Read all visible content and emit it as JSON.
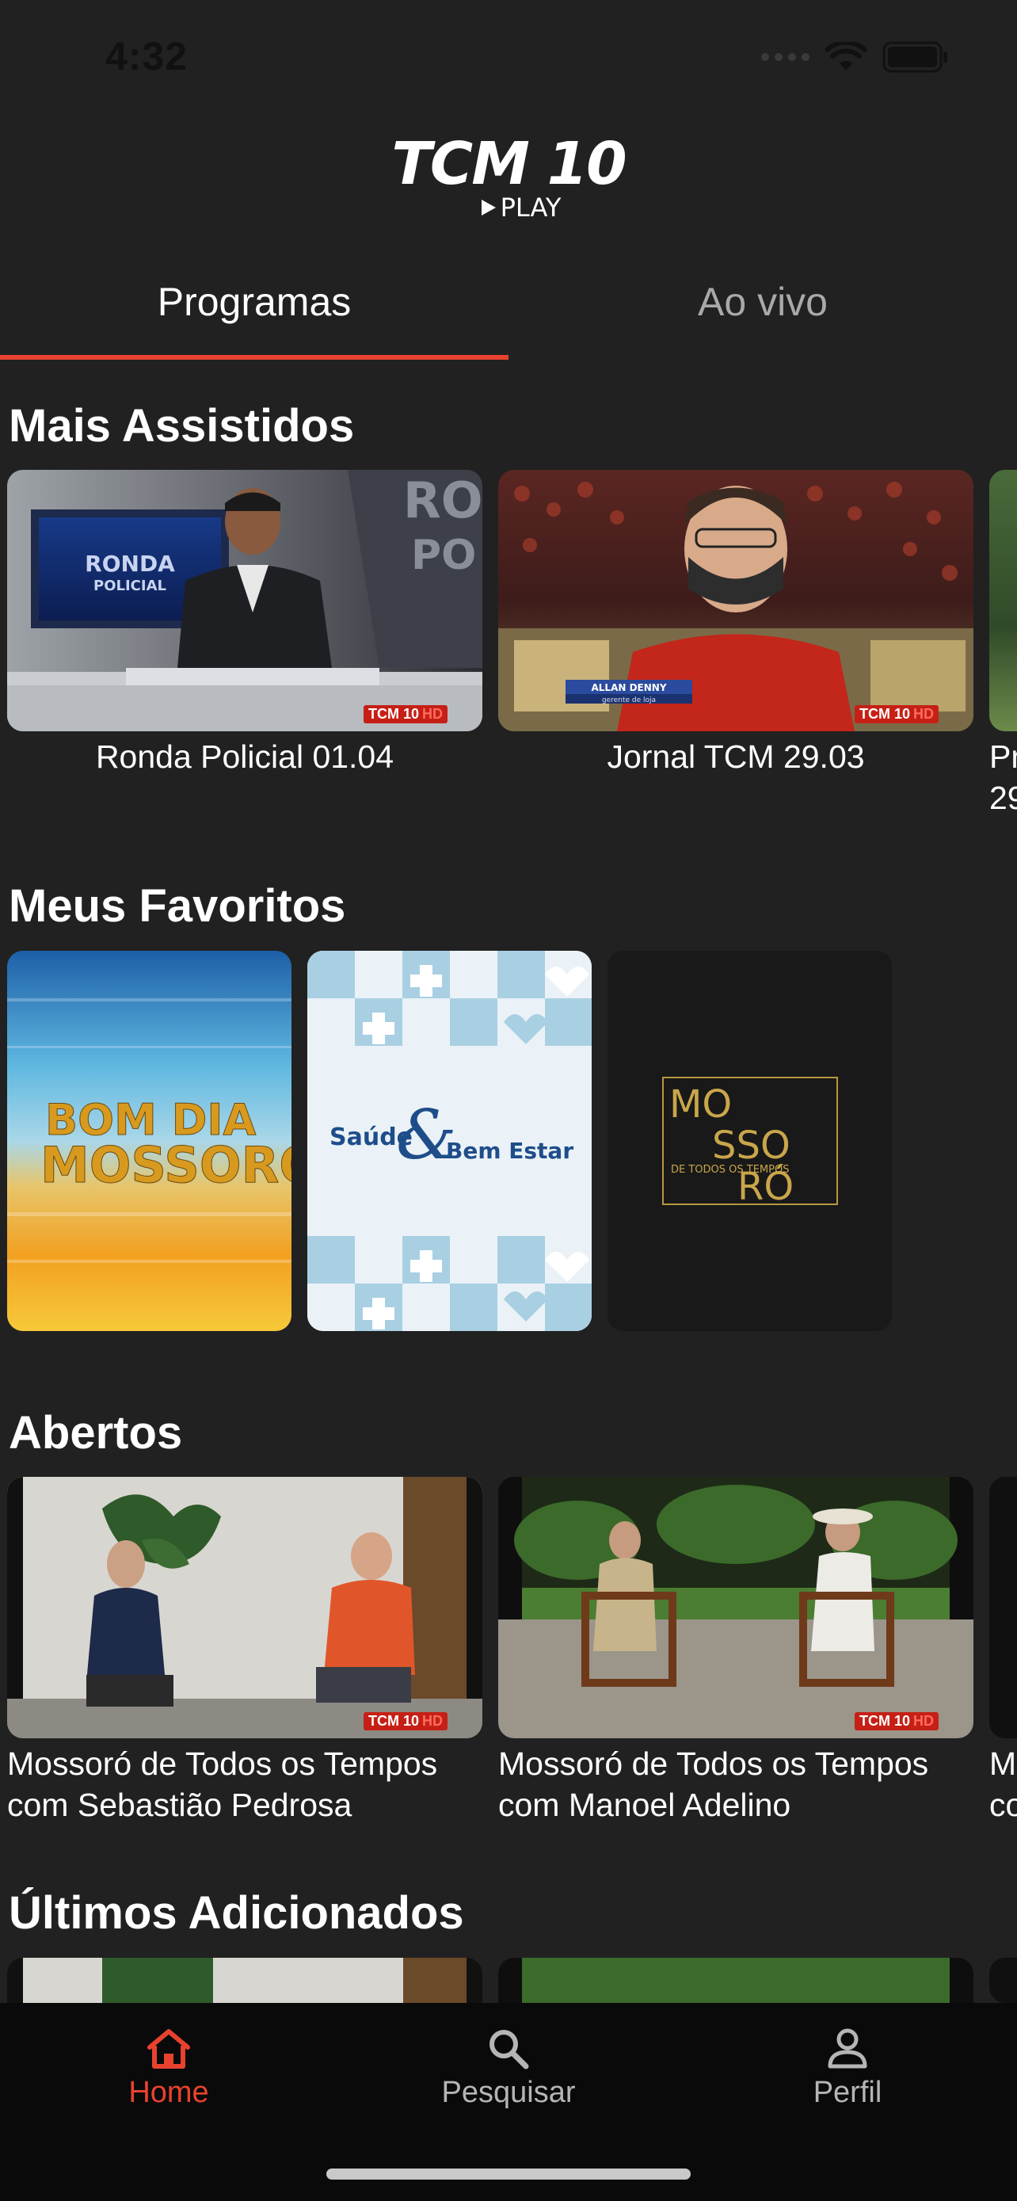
{
  "status_bar": {
    "time": "4:32"
  },
  "logo": {
    "main": "TCM 10",
    "sub": "PLAY"
  },
  "tabs": [
    {
      "label": "Programas",
      "active": true
    },
    {
      "label": "Ao vivo",
      "active": false
    }
  ],
  "sections": {
    "mais_assistidos": {
      "title": "Mais Assistidos",
      "items": [
        {
          "caption": "Ronda Policial 01.04",
          "thumb_text": "RONDA POLICIAL"
        },
        {
          "caption": "Jornal TCM 29.03",
          "lower_third_name": "ALLAN DENNY",
          "lower_third_role": "gerente de loja"
        },
        {
          "caption": "Pr 29"
        }
      ]
    },
    "meus_favoritos": {
      "title": "Meus Favoritos",
      "items": [
        {
          "line1": "BOM DIA",
          "line2": "MOSSORÓ"
        },
        {
          "text1": "Saúde",
          "amp": "&",
          "text2": "Bem Estar"
        },
        {
          "lines": [
            "MO",
            "SSO",
            "RÓ"
          ],
          "sub": "DE TODOS OS TEMPOS"
        }
      ]
    },
    "abertos": {
      "title": "Abertos",
      "items": [
        {
          "caption_line1": "Mossoró de Todos os Tempos",
          "caption_line2": "com Sebastião Pedrosa"
        },
        {
          "caption_line1": "Mossoró de Todos os Tempos",
          "caption_line2": "com Manoel Adelino"
        },
        {
          "caption_line1": "M",
          "caption_line2": "co"
        }
      ]
    },
    "ultimos_adicionados": {
      "title": "Últimos Adicionados"
    }
  },
  "badge": {
    "brand": "TCM 10",
    "hd": "HD"
  },
  "bottom_nav": [
    {
      "label": "Home",
      "icon": "home-icon",
      "active": true
    },
    {
      "label": "Pesquisar",
      "icon": "search-icon",
      "active": false
    },
    {
      "label": "Perfil",
      "icon": "person-icon",
      "active": false
    }
  ],
  "colors": {
    "accent": "#e8422f",
    "background": "#212121",
    "nav_background": "#0a0a0a",
    "inactive": "#a9a9a9"
  }
}
